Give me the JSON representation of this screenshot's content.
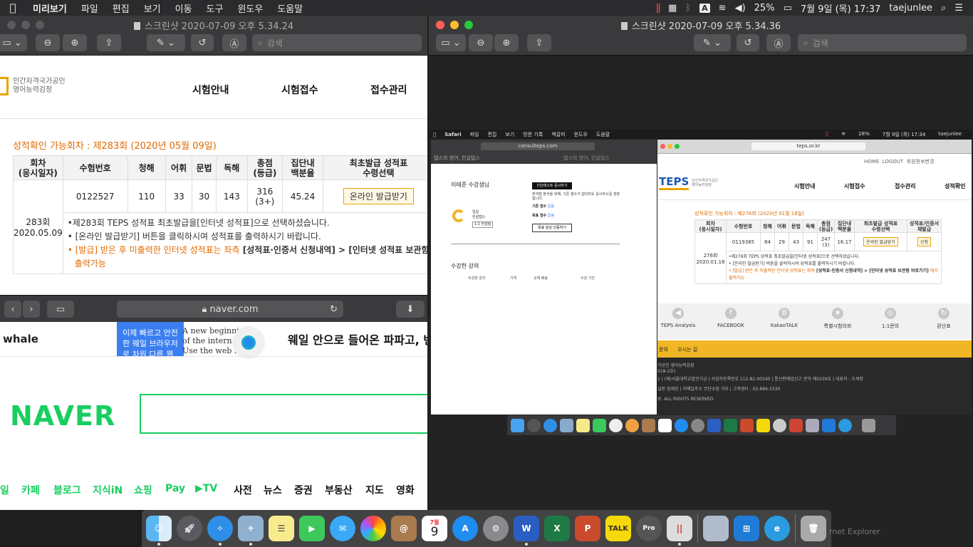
{
  "menubar": {
    "app": "미리보기",
    "items": [
      "파일",
      "편집",
      "보기",
      "이동",
      "도구",
      "윈도우",
      "도움말"
    ],
    "battery": "25%",
    "datetime": "7월 9일 (목)  17:37",
    "user": "taejunlee",
    "input_source": "A"
  },
  "left_window": {
    "title": "스크린샷 2020-07-09 오후 5.34.24",
    "search_placeholder": "검색",
    "logo_line1": "민간자격국가공인",
    "logo_line2": "영어능력검정",
    "nav": [
      "시험안내",
      "시험접수",
      "접수관리"
    ],
    "available": "성적확인 가능회차 : 제283회 (2020년 05월 09일)",
    "headers": {
      "round": "회차\n(응시일자)",
      "exam_no": "수험번호",
      "listening": "청해",
      "vocab": "어휘",
      "grammar": "문법",
      "reading": "독해",
      "total": "총점\n(등급)",
      "percentile": "집단내\n백분율",
      "first_issue": "최초발급 성적표\n수령선택"
    },
    "row": {
      "round": "283회",
      "date": "2020.05.09",
      "exam_no": "0122527",
      "listening": "110",
      "vocab": "33",
      "grammar": "30",
      "reading": "143",
      "total": "316",
      "grade": "(3+)",
      "percentile": "45.24",
      "issue_button": "온라인 발급받기"
    },
    "notes": {
      "n1": "•제283회 TEPS 성적표 최초발급을[인터넷 성적표]으로 선택하셨습니다.",
      "n2": "• [온라인 발급받기] 버튼을 클릭하시여 성적표를 출력하시기 바랍니다.",
      "n3a": "• [발급] 받은 후 미출력한 인터넷 성적표는 좌측",
      "n3b": " [성적표·인증서 신청내역] > [인터넷 성적표 보관함",
      "n3c": "출력가능"
    }
  },
  "naver_window": {
    "url": "naver.com",
    "whale": "whale",
    "ad_blue": "이제 빠르고 안전한 웨일 브라우저로 차원 다른 웹 서핑을",
    "ad_en1": "A new beginning",
    "ad_en2": "of the internet",
    "ad_en3": "Use the web faster",
    "ad_text": "웨일 안으로 들어온 파파고, 번",
    "logo": "NAVER",
    "menu": [
      "일",
      "카페",
      "블로그",
      "지식iN",
      "쇼핑",
      "Pay",
      "▶TV",
      "사전",
      "뉴스",
      "증권",
      "부동산",
      "지도",
      "영화"
    ]
  },
  "right_window": {
    "title": "스크린샷 2020-07-09 오후 5.34.36",
    "search_placeholder": "검색",
    "inner_menubar": {
      "app": "Safari",
      "items": [
        "파일",
        "편집",
        "보기",
        "방문 기록",
        "책갈피",
        "윈도우",
        "도움말"
      ],
      "battery": "28%",
      "datetime": "7월 9일 (목) 17:34",
      "user": "taejunlee"
    },
    "consult": {
      "url": "consulteps.com",
      "tab1": "텝스의 영어, 컨설텝스",
      "tab2": "텝스의 영어, 컨설텝스",
      "greeting": "이태준 수강생님",
      "btn_test": "진단테스트 응시하기",
      "desc": "취약점 분석을 위해, 기존 점수가 없더라도 응시하시길 권장합니다.",
      "score_label": "기존 점수",
      "score_val": "없음",
      "goal_label": "목표 점수",
      "goal_val": "없음",
      "btn_goal": "목표 달성 인증하기",
      "brand_line1": "일일",
      "brand_line2": "컨설텝스",
      "brand_tag": "1:1 컨설팅",
      "courses": "수강한 강의",
      "col1": "수강한 강의",
      "col2": "가격",
      "col3": "교재 배송",
      "col4": "수강 기간"
    },
    "teps": {
      "url": "teps.or.kr",
      "top_home": "HOME",
      "top_logout": "LOGOUT",
      "top_member": "회원정보변경",
      "logo": "TEPS",
      "logo_sub1": "민간자격국가공인",
      "logo_sub2": "영어능력검정",
      "nav": [
        "시험안내",
        "시험접수",
        "접수관리",
        "성적확인"
      ],
      "available": "성적확인 가능회차 : 제276회 (2020년 01월 18일)",
      "headers": [
        "회차\n(응시일자)",
        "수험번호",
        "청해",
        "어휘",
        "문법",
        "독해",
        "총점\n(등급)",
        "집단내\n백분율",
        "최초발급 성적표\n수령선택",
        "성적표/인증서\n재발급"
      ],
      "row": {
        "round": "276회",
        "date": "2020.01.18",
        "exam_no": "0119385",
        "listening": "84",
        "vocab": "29",
        "grammar": "43",
        "reading": "91",
        "total": "247",
        "grade": "(3)",
        "percentile": "16.17",
        "issue_button": "온라인 발급받기",
        "reissue_button": "신청"
      },
      "notes": {
        "n1": "•제276회 TEPS 성적표 최초발급을[인터넷 성적표]으로 선택하셨습니다.",
        "n2": "• [온라인 발급받기] 버튼을 클릭하시여 성적표를 출력하시기 바랍니다.",
        "n3a": "• [발급] 받은 후 미출력한 인터넷 성적표는 좌측",
        "n3b": " [성적표·인증서 신청내역] > [인터넷 성적표 보관함 바로가기]",
        "n3c": " 에서",
        "n3d": "출력가능"
      },
      "icons": [
        "TEPS Analysis",
        "FACEBOOK",
        "KakaoTALK",
        "특별시험의뢰",
        "1:1문의",
        "환산표"
      ],
      "icon_glyphs": [
        "◀",
        "f",
        "B",
        "★",
        "◎",
        "↻"
      ],
      "yellow": "문의      오시는 길",
      "footer1": "가공인 영어능력검정",
      "footer2": "018-2호)",
      "footer3": "1  |  (재)서울대학교발전기금  |  사업자등록번호 112-82-00240  |  통신판매업신고 관악 제0239호  |  대표자 : 오세정",
      "footer4": "실장 정재헌  |  이메일주소 무단수집 거부  |  고객센터 : 02-886-3330",
      "footer5": "보. ALL RIGHTS RESERVED."
    }
  },
  "dock": {
    "calendar_day": "9",
    "calendar_month": "7월",
    "talk": "TALK",
    "pro": "Pro",
    "peek": "rnet Explorer"
  }
}
